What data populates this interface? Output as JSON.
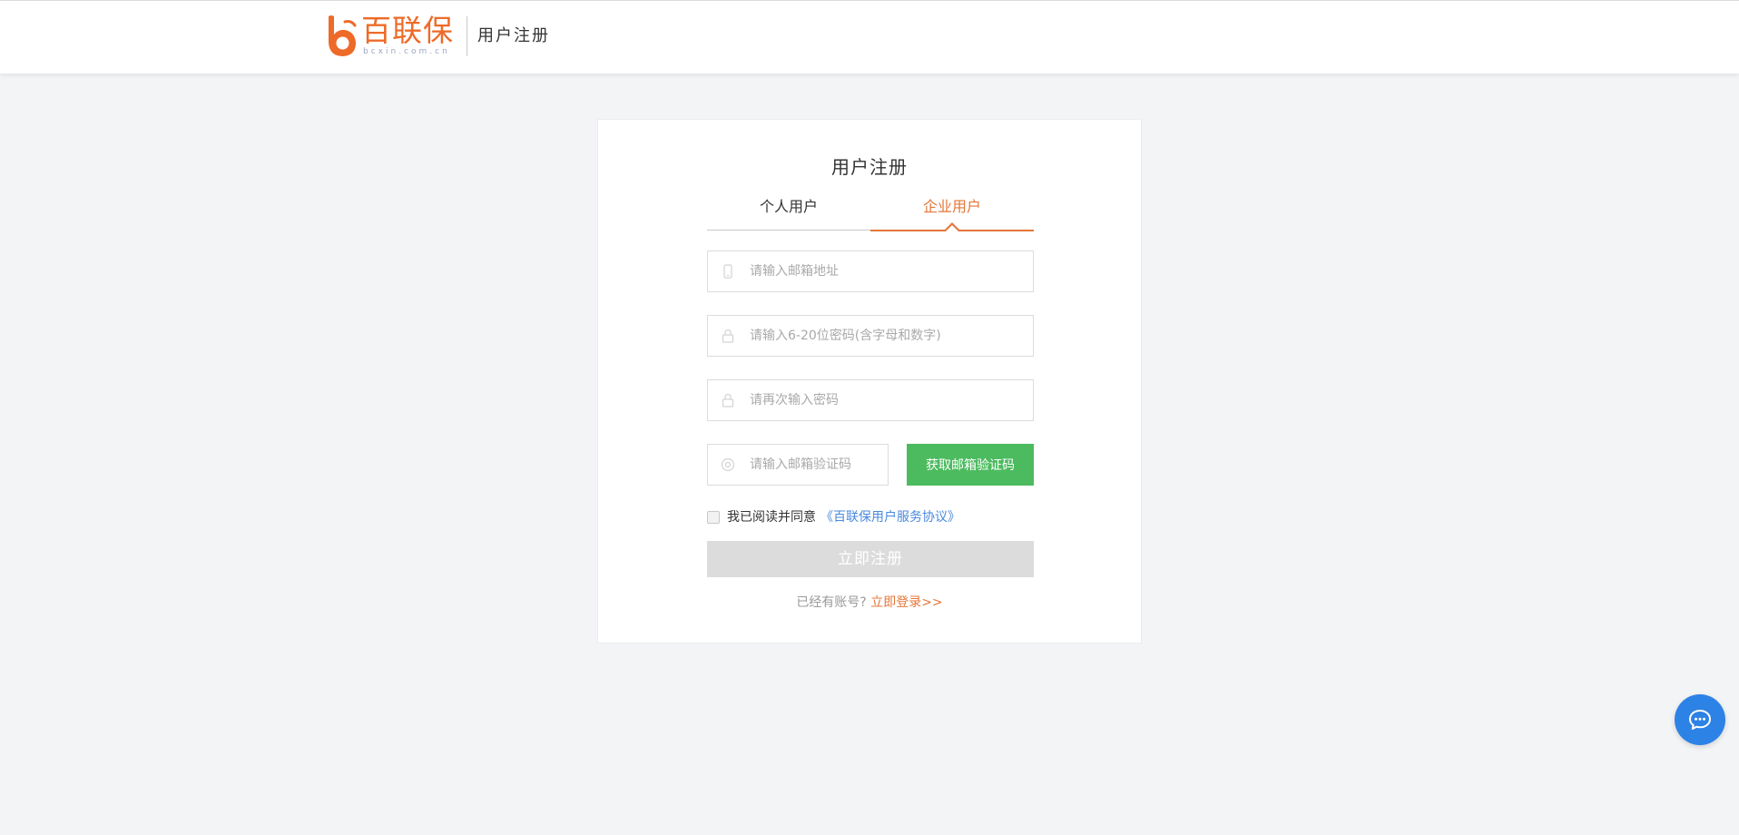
{
  "header": {
    "logo_text": "百联保",
    "logo_domain": "bcxin.com.cn",
    "title": "用户注册"
  },
  "card": {
    "title": "用户注册",
    "tabs": [
      {
        "label": "个人用户",
        "active": false
      },
      {
        "label": "企业用户",
        "active": true
      }
    ],
    "fields": {
      "email_placeholder": "请输入邮箱地址",
      "password_placeholder": "请输入6-20位密码(含字母和数字)",
      "confirm_placeholder": "请再次输入密码",
      "code_placeholder": "请输入邮箱验证码"
    },
    "get_code_label": "获取邮箱验证码",
    "agree_text": "我已阅读并同意",
    "agree_link": "《百联保用户服务协议》",
    "submit_label": "立即注册",
    "login_prompt": "已经有账号?",
    "login_link": "立即登录>>"
  },
  "icons": {
    "email_field": "phone-icon",
    "password_field": "lock-icon",
    "confirm_field": "lock-icon",
    "code_field": "shield-icon",
    "chat": "chat-bubble-icon"
  },
  "colors": {
    "brand_orange": "#ee6a28",
    "active_tab": "#e4773a",
    "code_button": "#4cbb5f",
    "link_blue": "#4a89dc",
    "chat_button": "#2d82e6",
    "submit_disabled": "#dcdcdc"
  }
}
